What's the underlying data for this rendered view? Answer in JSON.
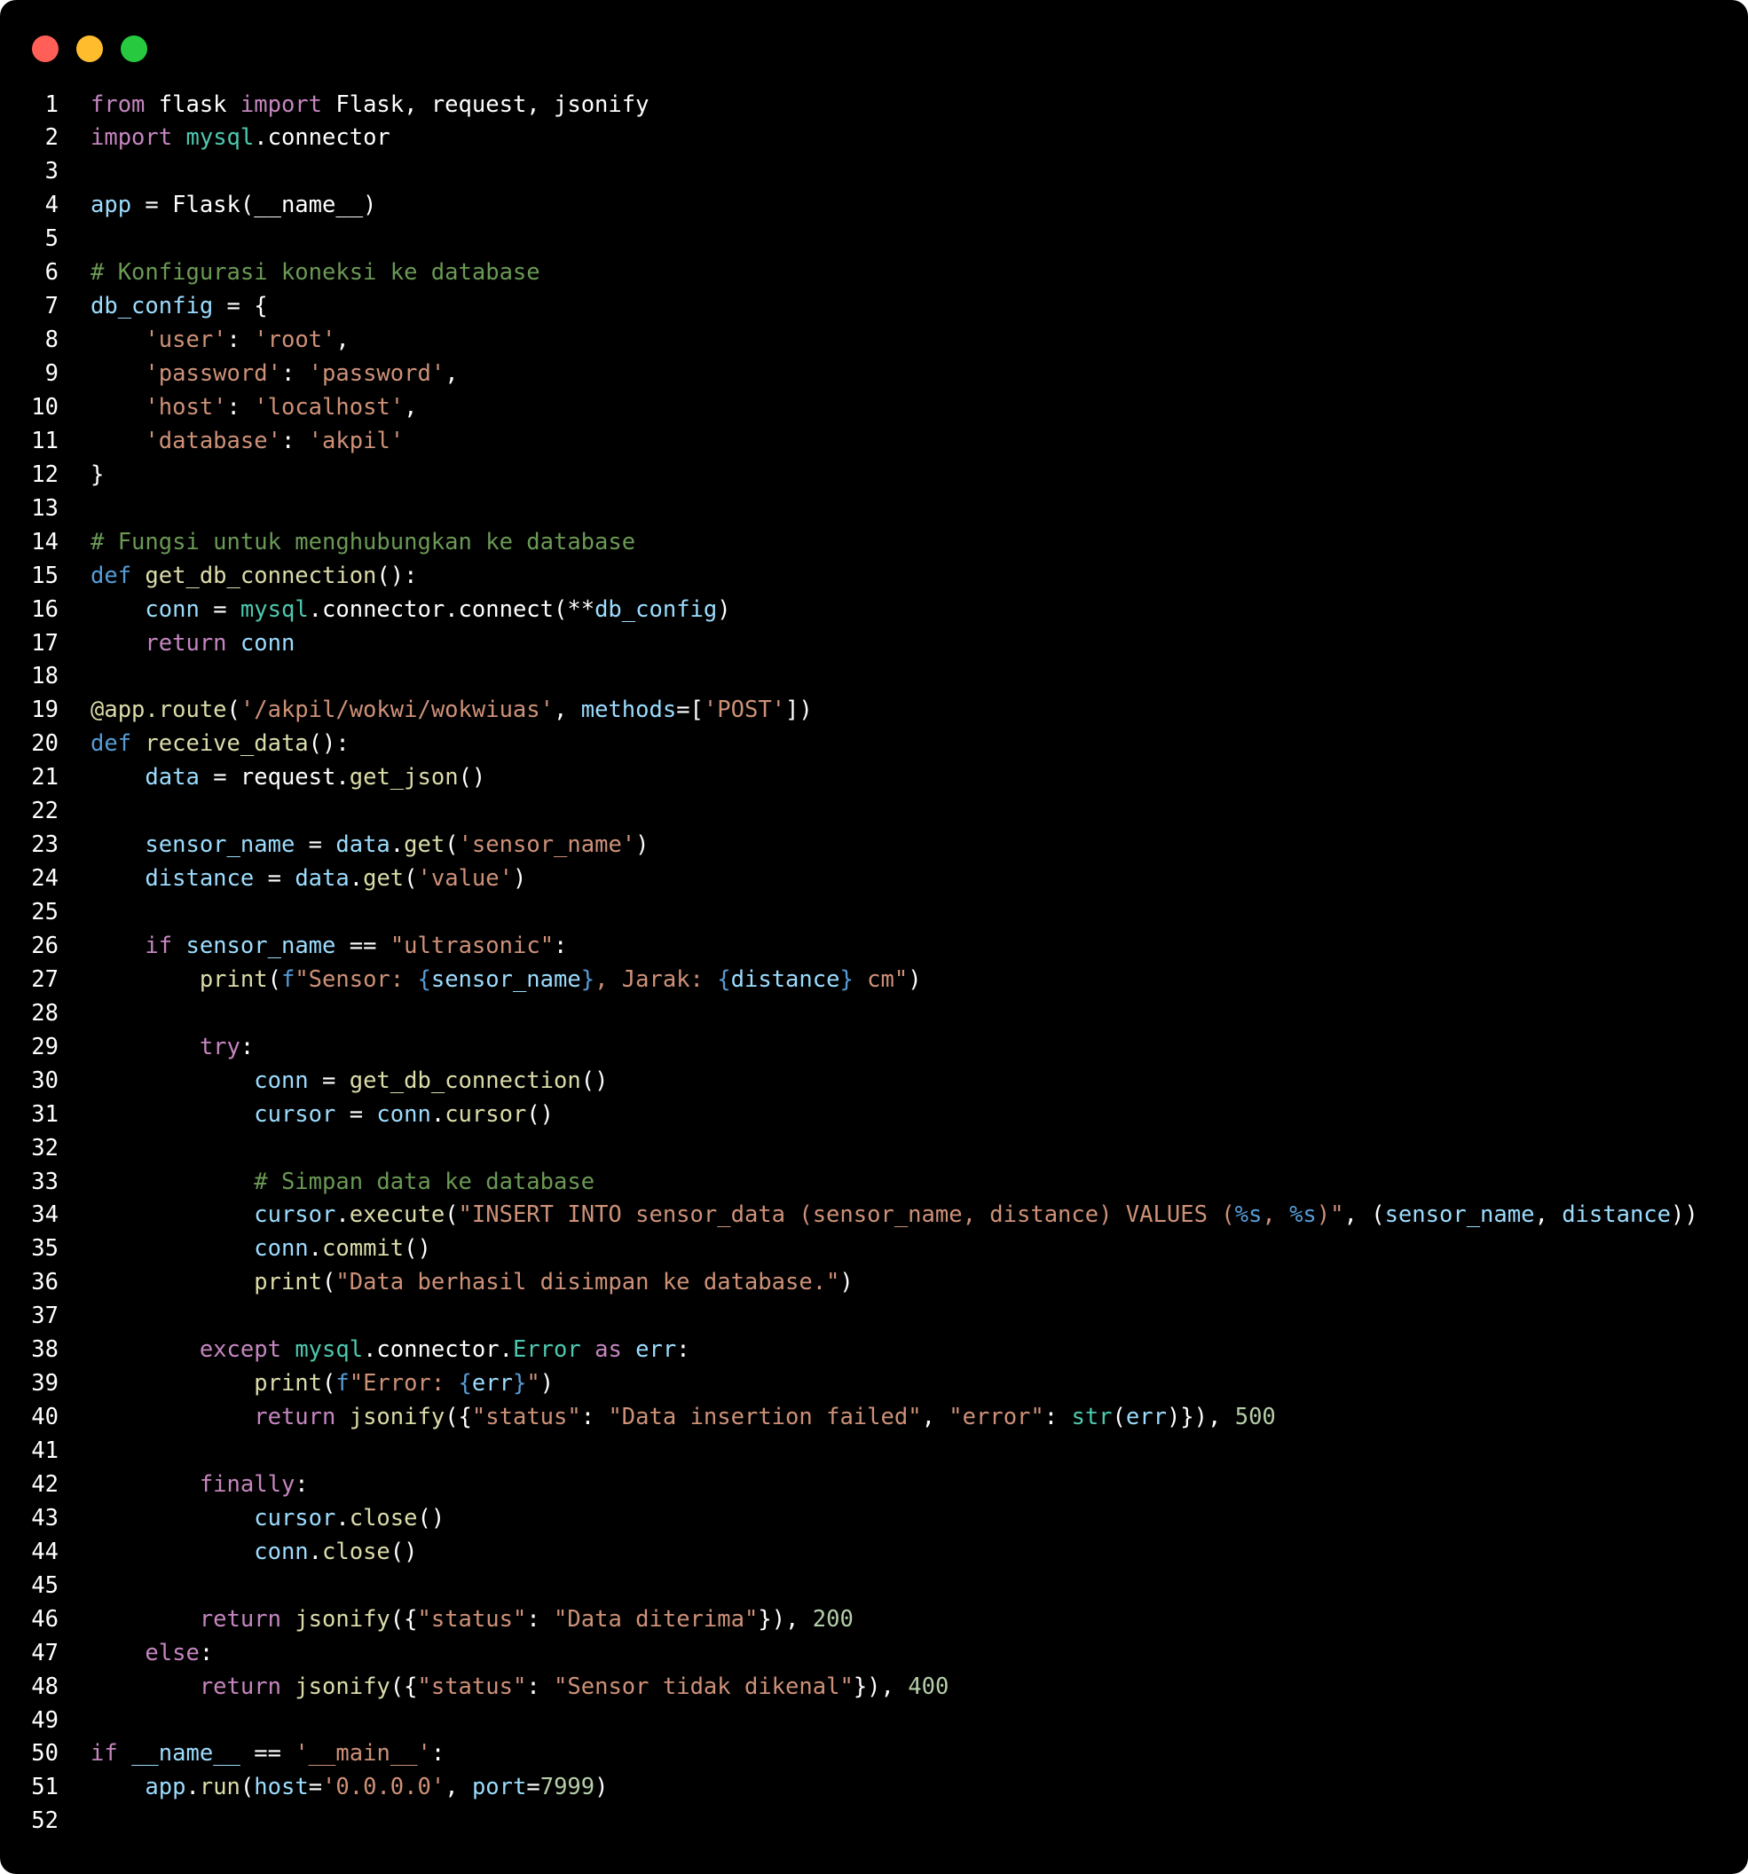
{
  "window": {
    "controls": [
      {
        "name": "close-icon",
        "color": "#ff5f56"
      },
      {
        "name": "minimize-icon",
        "color": "#ffbd2e"
      },
      {
        "name": "maximize-icon",
        "color": "#27c93f"
      }
    ]
  },
  "colors": {
    "k": "#c586c0",
    "d": "#569cd6",
    "v": "#9cdcfe",
    "f": "#dcdcaa",
    "s": "#ce9178",
    "c": "#6a9955",
    "n": "#b5cea8",
    "m": "#4ec9b0",
    "p": "#ffffff"
  },
  "code": {
    "lines": [
      {
        "num": "1",
        "tokens": [
          [
            "k",
            "from"
          ],
          [
            "p",
            " flask "
          ],
          [
            "k",
            "import"
          ],
          [
            "p",
            " Flask, request, jsonify"
          ]
        ]
      },
      {
        "num": "2",
        "tokens": [
          [
            "k",
            "import"
          ],
          [
            "p",
            " "
          ],
          [
            "m",
            "mysql"
          ],
          [
            "p",
            ".connector"
          ]
        ]
      },
      {
        "num": "3",
        "tokens": []
      },
      {
        "num": "4",
        "tokens": [
          [
            "v",
            "app"
          ],
          [
            "p",
            " = Flask(__name__)"
          ]
        ]
      },
      {
        "num": "5",
        "tokens": []
      },
      {
        "num": "6",
        "tokens": [
          [
            "c",
            "# Konfigurasi koneksi ke database"
          ]
        ]
      },
      {
        "num": "7",
        "tokens": [
          [
            "v",
            "db_config"
          ],
          [
            "p",
            " = {"
          ]
        ]
      },
      {
        "num": "8",
        "tokens": [
          [
            "p",
            "    "
          ],
          [
            "s",
            "'user'"
          ],
          [
            "p",
            ": "
          ],
          [
            "s",
            "'root'"
          ],
          [
            "p",
            ","
          ]
        ]
      },
      {
        "num": "9",
        "tokens": [
          [
            "p",
            "    "
          ],
          [
            "s",
            "'password'"
          ],
          [
            "p",
            ": "
          ],
          [
            "s",
            "'password'"
          ],
          [
            "p",
            ","
          ]
        ]
      },
      {
        "num": "10",
        "tokens": [
          [
            "p",
            "    "
          ],
          [
            "s",
            "'host'"
          ],
          [
            "p",
            ": "
          ],
          [
            "s",
            "'localhost'"
          ],
          [
            "p",
            ","
          ]
        ]
      },
      {
        "num": "11",
        "tokens": [
          [
            "p",
            "    "
          ],
          [
            "s",
            "'database'"
          ],
          [
            "p",
            ": "
          ],
          [
            "s",
            "'akpil'"
          ]
        ]
      },
      {
        "num": "12",
        "tokens": [
          [
            "p",
            "}"
          ]
        ]
      },
      {
        "num": "13",
        "tokens": []
      },
      {
        "num": "14",
        "tokens": [
          [
            "c",
            "# Fungsi untuk menghubungkan ke database"
          ]
        ]
      },
      {
        "num": "15",
        "tokens": [
          [
            "d",
            "def"
          ],
          [
            "p",
            " "
          ],
          [
            "f",
            "get_db_connection"
          ],
          [
            "p",
            "():"
          ]
        ]
      },
      {
        "num": "16",
        "tokens": [
          [
            "p",
            "    "
          ],
          [
            "v",
            "conn"
          ],
          [
            "p",
            " = "
          ],
          [
            "m",
            "mysql"
          ],
          [
            "p",
            ".connector.connect(**"
          ],
          [
            "v",
            "db_config"
          ],
          [
            "p",
            ")"
          ]
        ]
      },
      {
        "num": "17",
        "tokens": [
          [
            "p",
            "    "
          ],
          [
            "k",
            "return"
          ],
          [
            "p",
            " "
          ],
          [
            "v",
            "conn"
          ]
        ]
      },
      {
        "num": "18",
        "tokens": []
      },
      {
        "num": "19",
        "tokens": [
          [
            "f",
            "@app.route"
          ],
          [
            "p",
            "("
          ],
          [
            "s",
            "'/akpil/wokwi/wokwiuas'"
          ],
          [
            "p",
            ", "
          ],
          [
            "v",
            "methods"
          ],
          [
            "p",
            "=["
          ],
          [
            "s",
            "'POST'"
          ],
          [
            "p",
            "])"
          ]
        ]
      },
      {
        "num": "20",
        "tokens": [
          [
            "d",
            "def"
          ],
          [
            "p",
            " "
          ],
          [
            "f",
            "receive_data"
          ],
          [
            "p",
            "():"
          ]
        ]
      },
      {
        "num": "21",
        "tokens": [
          [
            "p",
            "    "
          ],
          [
            "v",
            "data"
          ],
          [
            "p",
            " = request."
          ],
          [
            "f",
            "get_json"
          ],
          [
            "p",
            "()"
          ]
        ]
      },
      {
        "num": "22",
        "tokens": []
      },
      {
        "num": "23",
        "tokens": [
          [
            "p",
            "    "
          ],
          [
            "v",
            "sensor_name"
          ],
          [
            "p",
            " = "
          ],
          [
            "v",
            "data"
          ],
          [
            "p",
            "."
          ],
          [
            "f",
            "get"
          ],
          [
            "p",
            "("
          ],
          [
            "s",
            "'sensor_name'"
          ],
          [
            "p",
            ")"
          ]
        ]
      },
      {
        "num": "24",
        "tokens": [
          [
            "p",
            "    "
          ],
          [
            "v",
            "distance"
          ],
          [
            "p",
            " = "
          ],
          [
            "v",
            "data"
          ],
          [
            "p",
            "."
          ],
          [
            "f",
            "get"
          ],
          [
            "p",
            "("
          ],
          [
            "s",
            "'value'"
          ],
          [
            "p",
            ")"
          ]
        ]
      },
      {
        "num": "25",
        "tokens": []
      },
      {
        "num": "26",
        "tokens": [
          [
            "p",
            "    "
          ],
          [
            "k",
            "if"
          ],
          [
            "p",
            " "
          ],
          [
            "v",
            "sensor_name"
          ],
          [
            "p",
            " == "
          ],
          [
            "s",
            "\"ultrasonic\""
          ],
          [
            "p",
            ":"
          ]
        ]
      },
      {
        "num": "27",
        "tokens": [
          [
            "p",
            "        "
          ],
          [
            "f",
            "print"
          ],
          [
            "p",
            "("
          ],
          [
            "d",
            "f"
          ],
          [
            "s",
            "\"Sensor: "
          ],
          [
            "d",
            "{"
          ],
          [
            "v",
            "sensor_name"
          ],
          [
            "d",
            "}"
          ],
          [
            "s",
            ", Jarak: "
          ],
          [
            "d",
            "{"
          ],
          [
            "v",
            "distance"
          ],
          [
            "d",
            "}"
          ],
          [
            "s",
            " cm\""
          ],
          [
            "p",
            ")"
          ]
        ]
      },
      {
        "num": "28",
        "tokens": []
      },
      {
        "num": "29",
        "tokens": [
          [
            "p",
            "        "
          ],
          [
            "k",
            "try"
          ],
          [
            "p",
            ":"
          ]
        ]
      },
      {
        "num": "30",
        "tokens": [
          [
            "p",
            "            "
          ],
          [
            "v",
            "conn"
          ],
          [
            "p",
            " = "
          ],
          [
            "f",
            "get_db_connection"
          ],
          [
            "p",
            "()"
          ]
        ]
      },
      {
        "num": "31",
        "tokens": [
          [
            "p",
            "            "
          ],
          [
            "v",
            "cursor"
          ],
          [
            "p",
            " = "
          ],
          [
            "v",
            "conn"
          ],
          [
            "p",
            "."
          ],
          [
            "f",
            "cursor"
          ],
          [
            "p",
            "()"
          ]
        ]
      },
      {
        "num": "32",
        "tokens": []
      },
      {
        "num": "33",
        "tokens": [
          [
            "p",
            "            "
          ],
          [
            "c",
            "# Simpan data ke database"
          ]
        ]
      },
      {
        "num": "34",
        "tokens": [
          [
            "p",
            "            "
          ],
          [
            "v",
            "cursor"
          ],
          [
            "p",
            "."
          ],
          [
            "f",
            "execute"
          ],
          [
            "p",
            "("
          ],
          [
            "s",
            "\"INSERT INTO sensor_data (sensor_name, distance) VALUES ("
          ],
          [
            "d",
            "%s"
          ],
          [
            "s",
            ", "
          ],
          [
            "d",
            "%s"
          ],
          [
            "s",
            ")\""
          ],
          [
            "p",
            ", ("
          ],
          [
            "v",
            "sensor_name"
          ],
          [
            "p",
            ", "
          ],
          [
            "v",
            "distance"
          ],
          [
            "p",
            "))"
          ]
        ]
      },
      {
        "num": "35",
        "tokens": [
          [
            "p",
            "            "
          ],
          [
            "v",
            "conn"
          ],
          [
            "p",
            "."
          ],
          [
            "f",
            "commit"
          ],
          [
            "p",
            "()"
          ]
        ]
      },
      {
        "num": "36",
        "tokens": [
          [
            "p",
            "            "
          ],
          [
            "f",
            "print"
          ],
          [
            "p",
            "("
          ],
          [
            "s",
            "\"Data berhasil disimpan ke database.\""
          ],
          [
            "p",
            ")"
          ]
        ]
      },
      {
        "num": "37",
        "tokens": []
      },
      {
        "num": "38",
        "tokens": [
          [
            "p",
            "        "
          ],
          [
            "k",
            "except"
          ],
          [
            "p",
            " "
          ],
          [
            "m",
            "mysql"
          ],
          [
            "p",
            ".connector."
          ],
          [
            "m",
            "Error"
          ],
          [
            "p",
            " "
          ],
          [
            "k",
            "as"
          ],
          [
            "p",
            " "
          ],
          [
            "v",
            "err"
          ],
          [
            "p",
            ":"
          ]
        ]
      },
      {
        "num": "39",
        "tokens": [
          [
            "p",
            "            "
          ],
          [
            "f",
            "print"
          ],
          [
            "p",
            "("
          ],
          [
            "d",
            "f"
          ],
          [
            "s",
            "\"Error: "
          ],
          [
            "d",
            "{"
          ],
          [
            "v",
            "err"
          ],
          [
            "d",
            "}"
          ],
          [
            "s",
            "\""
          ],
          [
            "p",
            ")"
          ]
        ]
      },
      {
        "num": "40",
        "tokens": [
          [
            "p",
            "            "
          ],
          [
            "k",
            "return"
          ],
          [
            "p",
            " "
          ],
          [
            "f",
            "jsonify"
          ],
          [
            "p",
            "({"
          ],
          [
            "s",
            "\"status\""
          ],
          [
            "p",
            ": "
          ],
          [
            "s",
            "\"Data insertion failed\""
          ],
          [
            "p",
            ", "
          ],
          [
            "s",
            "\"error\""
          ],
          [
            "p",
            ": "
          ],
          [
            "m",
            "str"
          ],
          [
            "p",
            "("
          ],
          [
            "v",
            "err"
          ],
          [
            "p",
            ")}), "
          ],
          [
            "n",
            "500"
          ]
        ]
      },
      {
        "num": "41",
        "tokens": []
      },
      {
        "num": "42",
        "tokens": [
          [
            "p",
            "        "
          ],
          [
            "k",
            "finally"
          ],
          [
            "p",
            ":"
          ]
        ]
      },
      {
        "num": "43",
        "tokens": [
          [
            "p",
            "            "
          ],
          [
            "v",
            "cursor"
          ],
          [
            "p",
            "."
          ],
          [
            "f",
            "close"
          ],
          [
            "p",
            "()"
          ]
        ]
      },
      {
        "num": "44",
        "tokens": [
          [
            "p",
            "            "
          ],
          [
            "v",
            "conn"
          ],
          [
            "p",
            "."
          ],
          [
            "f",
            "close"
          ],
          [
            "p",
            "()"
          ]
        ]
      },
      {
        "num": "45",
        "tokens": []
      },
      {
        "num": "46",
        "tokens": [
          [
            "p",
            "        "
          ],
          [
            "k",
            "return"
          ],
          [
            "p",
            " "
          ],
          [
            "f",
            "jsonify"
          ],
          [
            "p",
            "({"
          ],
          [
            "s",
            "\"status\""
          ],
          [
            "p",
            ": "
          ],
          [
            "s",
            "\"Data diterima\""
          ],
          [
            "p",
            "}), "
          ],
          [
            "n",
            "200"
          ]
        ]
      },
      {
        "num": "47",
        "tokens": [
          [
            "p",
            "    "
          ],
          [
            "k",
            "else"
          ],
          [
            "p",
            ":"
          ]
        ]
      },
      {
        "num": "48",
        "tokens": [
          [
            "p",
            "        "
          ],
          [
            "k",
            "return"
          ],
          [
            "p",
            " "
          ],
          [
            "f",
            "jsonify"
          ],
          [
            "p",
            "({"
          ],
          [
            "s",
            "\"status\""
          ],
          [
            "p",
            ": "
          ],
          [
            "s",
            "\"Sensor tidak dikenal\""
          ],
          [
            "p",
            "}), "
          ],
          [
            "n",
            "400"
          ]
        ]
      },
      {
        "num": "49",
        "tokens": []
      },
      {
        "num": "50",
        "tokens": [
          [
            "k",
            "if"
          ],
          [
            "p",
            " "
          ],
          [
            "v",
            "__name__"
          ],
          [
            "p",
            " == "
          ],
          [
            "s",
            "'__main__'"
          ],
          [
            "p",
            ":"
          ]
        ]
      },
      {
        "num": "51",
        "tokens": [
          [
            "p",
            "    "
          ],
          [
            "v",
            "app"
          ],
          [
            "p",
            "."
          ],
          [
            "f",
            "run"
          ],
          [
            "p",
            "("
          ],
          [
            "v",
            "host"
          ],
          [
            "p",
            "="
          ],
          [
            "s",
            "'0.0.0.0'"
          ],
          [
            "p",
            ", "
          ],
          [
            "v",
            "port"
          ],
          [
            "p",
            "="
          ],
          [
            "n",
            "7999"
          ],
          [
            "p",
            ")"
          ]
        ]
      },
      {
        "num": "52",
        "tokens": []
      }
    ]
  }
}
